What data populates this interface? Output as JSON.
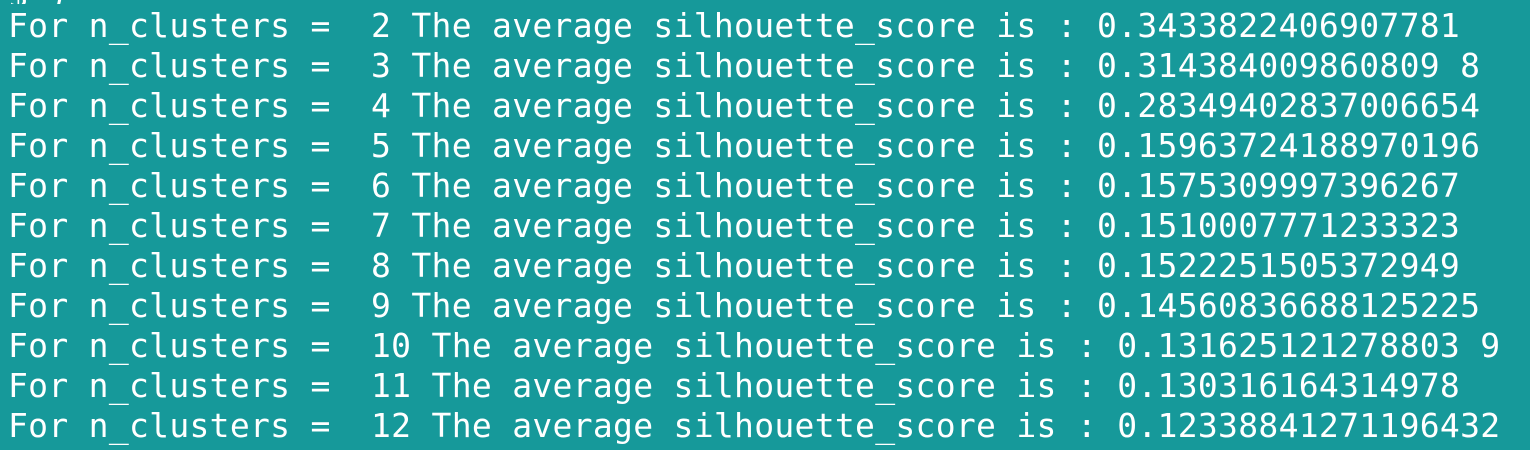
{
  "terminal": {
    "background_color": "#16999a",
    "text_color": "#ffffff",
    "partial_top_line": "$ )",
    "lines": [
      "For n_clusters =  2 The average silhouette_score is : 0.3433822406907781",
      "For n_clusters =  3 The average silhouette_score is : 0.314384009860809 8",
      "For n_clusters =  4 The average silhouette_score is : 0.28349402837006654",
      "For n_clusters =  5 The average silhouette_score is : 0.15963724188970196",
      "For n_clusters =  6 The average silhouette_score is : 0.1575309997396267",
      "For n_clusters =  7 The average silhouette_score is : 0.1510007771233323",
      "For n_clusters =  8 The average silhouette_score is : 0.1522251505372949",
      "For n_clusters =  9 The average silhouette_score is : 0.14560836688125225",
      "For n_clusters =  10 The average silhouette_score is : 0.131625121278803 9",
      "For n_clusters =  11 The average silhouette_score is : 0.130316164314978",
      "For n_clusters =  12 The average silhouette_score is : 0.12338841271196432"
    ]
  }
}
